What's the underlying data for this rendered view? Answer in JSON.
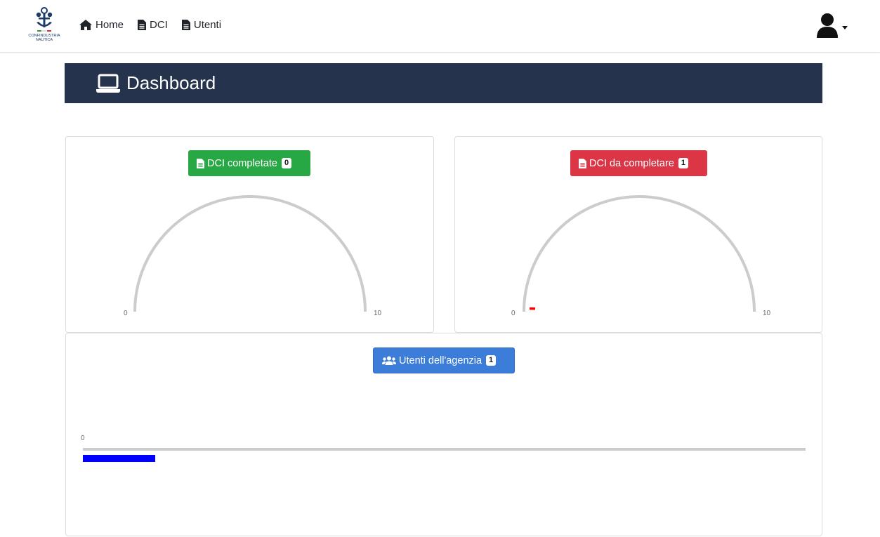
{
  "logo": {
    "name": "Confindustria Nautica",
    "text_line1": "CONFINDUSTRIA",
    "text_line2": "NAUTICA"
  },
  "nav": [
    {
      "label": "Home",
      "icon": "home-icon"
    },
    {
      "label": "DCI",
      "icon": "document-icon"
    },
    {
      "label": "Utenti",
      "icon": "document-icon"
    }
  ],
  "user_menu": {
    "icon": "user-icon"
  },
  "header": {
    "title": "Dashboard",
    "icon": "laptop-icon",
    "background": "#25344c"
  },
  "cards": {
    "completed": {
      "label": "DCI completate",
      "badge": "0",
      "color": "#28a745",
      "gauge_value": 0,
      "gauge_min": "0",
      "gauge_max": "10"
    },
    "to_complete": {
      "label": "DCI da completare",
      "badge": "1",
      "color": "#dc3545",
      "gauge_value": 1,
      "gauge_min": "0",
      "gauge_max": "10",
      "fill_color": "#ff0000"
    },
    "users": {
      "label": "Utenti dell'agenzia",
      "badge": "1",
      "color": "#3b7dd8",
      "bar_min": "0",
      "bar_value": 1,
      "fill_color": "#0000ff"
    }
  }
}
